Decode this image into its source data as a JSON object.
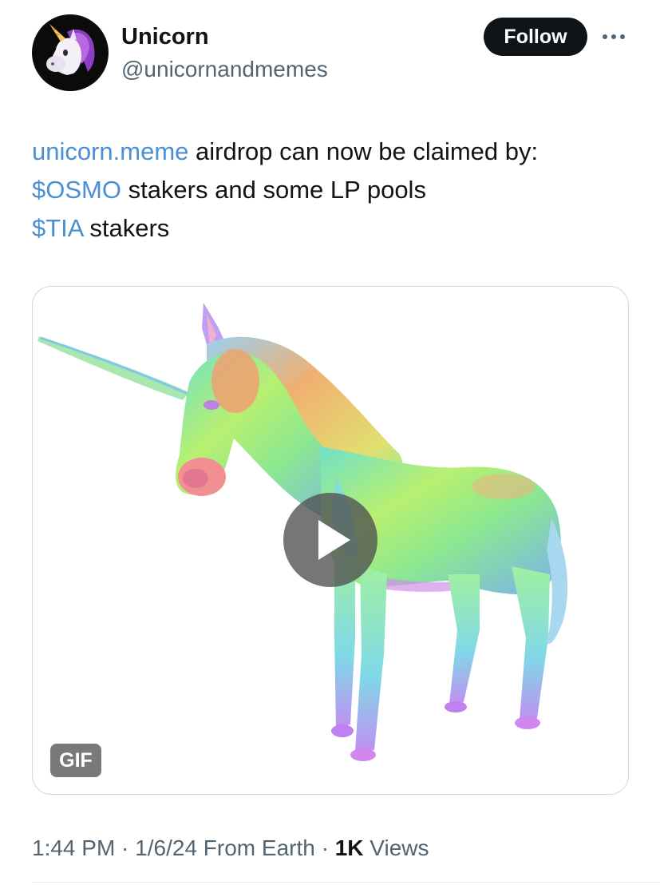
{
  "author": {
    "display_name": "Unicorn",
    "handle": "@unicornandmemes",
    "avatar_icon": "unicorn-emoji-icon"
  },
  "follow_label": "Follow",
  "more_icon": "more-horizontal-icon",
  "tweet": {
    "line1_link": "unicorn.meme",
    "line1_rest": " airdrop can now be claimed by:",
    "line2_link": "$OSMO",
    "line2_rest": " stakers and some LP pools",
    "line3_link": "$TIA",
    "line3_rest": " stakers"
  },
  "media": {
    "badge": "GIF",
    "play_icon": "play-icon"
  },
  "meta": {
    "time": "1:44 PM",
    "sep1": " · ",
    "date": "1/6/24",
    "source": " From Earth",
    "sep2": " · ",
    "views_count": "1K",
    "views_label": " Views"
  },
  "colors": {
    "link": "#4a8fd4",
    "follow_bg": "#0f1419",
    "secondary_text": "#536471"
  }
}
